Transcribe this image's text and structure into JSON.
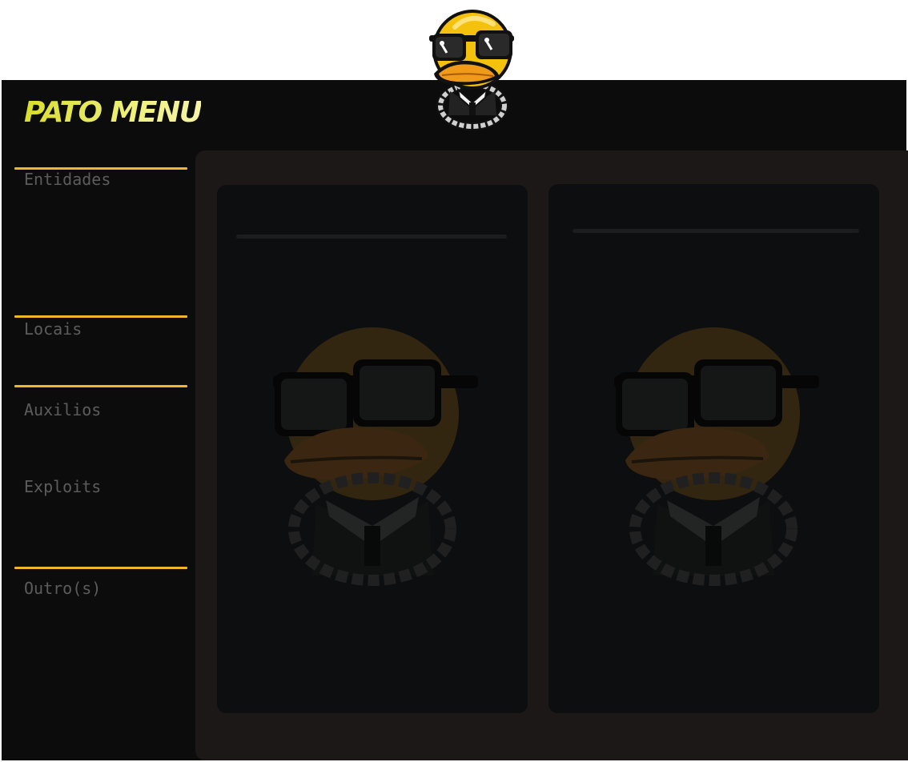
{
  "header": {
    "title": "PATO MENU",
    "logo_icon": "duck-sunglasses-logo-icon"
  },
  "sidebar": {
    "items": [
      {
        "label": "Entidades"
      },
      {
        "label": "Locais"
      },
      {
        "label": "Auxilios"
      },
      {
        "label": "Exploits"
      },
      {
        "label": "Outro(s)"
      }
    ]
  },
  "panels": [
    {
      "art_icon": "duck-watermark-icon"
    },
    {
      "art_icon": "duck-watermark-icon"
    }
  ],
  "colors": {
    "background": "#0c0c0d",
    "content_area": "#1b1817",
    "panel": "#0d0e0f",
    "accent_divider": "#f0b62a",
    "title": "#ecef6a",
    "nav_text": "#5c5c5c"
  }
}
